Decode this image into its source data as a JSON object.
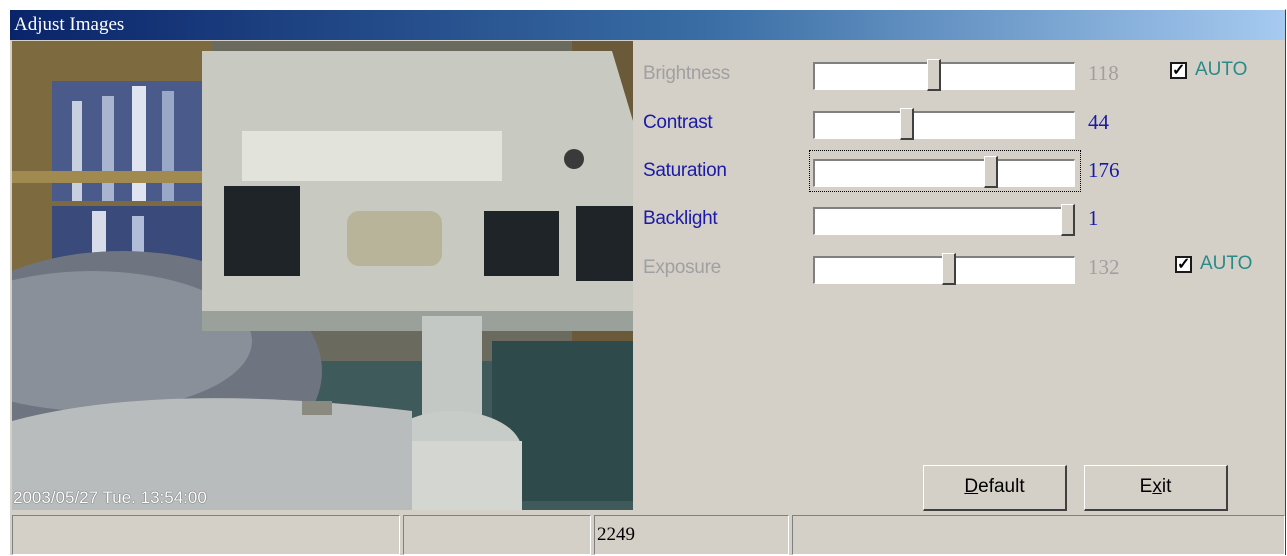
{
  "window": {
    "title": "Adjust Images"
  },
  "preview": {
    "timestamp": "2003/05/27 Tue. 13:54:00"
  },
  "controls": [
    {
      "label": "Brightness",
      "value": "118",
      "level": 0.46,
      "enabled": false,
      "auto": {
        "checked": true,
        "label": "AUTO"
      }
    },
    {
      "label": "Contrast",
      "value": "44",
      "level": 0.35,
      "enabled": true
    },
    {
      "label": "Saturation",
      "value": "176",
      "level": 0.69,
      "enabled": true,
      "focused": true
    },
    {
      "label": "Backlight",
      "value": "1",
      "level": 1.0,
      "enabled": true
    },
    {
      "label": "Exposure",
      "value": "132",
      "level": 0.52,
      "enabled": false,
      "auto": {
        "checked": true,
        "label": "AUTO"
      }
    }
  ],
  "buttons": {
    "default": {
      "mnemonic": "D",
      "rest": "efault"
    },
    "exit": {
      "pre": "E",
      "mnemonic": "x",
      "rest": "it"
    }
  },
  "statusbar": {
    "panes": [
      "",
      "",
      "2249",
      ""
    ]
  },
  "colors": {
    "title_start": "#0a246a",
    "title_end": "#a6caf0",
    "label_blue": "#1a1aa6",
    "disabled": "#a0a0a0",
    "auto_teal": "#2a8a8a"
  }
}
